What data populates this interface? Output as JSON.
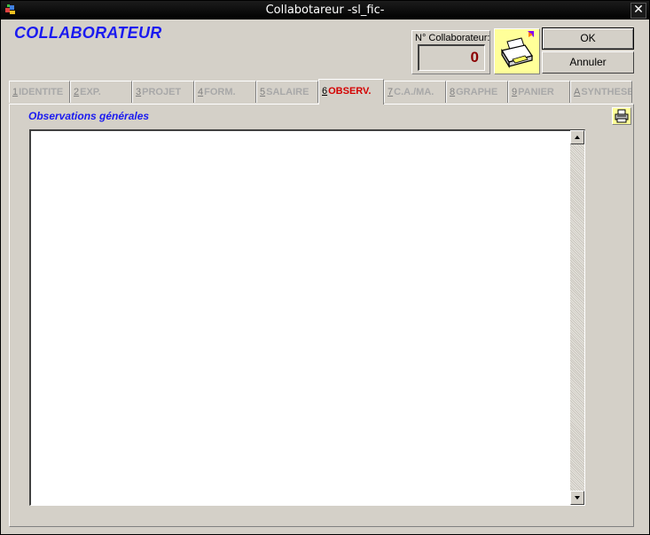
{
  "window": {
    "title": "Collabotareur -sl_fic-",
    "close_glyph": "✕",
    "app_icon": "app-icon"
  },
  "header": {
    "form_title": "COLLABORATEUR",
    "collaborator_number": {
      "label": "N° Collaborateur:",
      "value": "0"
    },
    "print_icon": "printer-icon",
    "ok_label": "OK",
    "cancel_label": "Annuler"
  },
  "tabs": [
    {
      "num": "1",
      "label": "IDENTITE",
      "active": false
    },
    {
      "num": "2",
      "label": "EXP.",
      "active": false
    },
    {
      "num": "3",
      "label": "PROJET",
      "active": false
    },
    {
      "num": "4",
      "label": "FORM.",
      "active": false
    },
    {
      "num": "5",
      "label": "SALAIRE",
      "active": false
    },
    {
      "num": "6",
      "label": "OBSERV.",
      "active": true
    },
    {
      "num": "7",
      "label": "C.A./MA.",
      "active": false
    },
    {
      "num": "8",
      "label": "GRAPHE",
      "active": false
    },
    {
      "num": "9",
      "label": "PANIER",
      "active": false
    },
    {
      "num": "A",
      "label": "SYNTHESE",
      "active": false
    }
  ],
  "panel": {
    "title": "Observations générales",
    "notes_value": ""
  },
  "colors": {
    "title_blue": "#1a1af0",
    "active_tab_red": "#d40000",
    "number_red": "#8b0000",
    "print_yellow": "#ffff99",
    "window_gray": "#d4d0c8"
  }
}
